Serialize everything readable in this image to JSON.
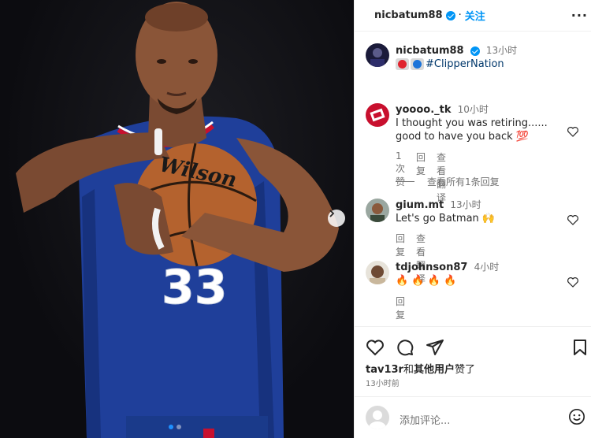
{
  "post": {
    "author": "nicbatum88",
    "follow_label": "关注",
    "separator": "·",
    "more_label": "···",
    "caption_time": "13小时",
    "caption_hashtag": "#ClipperNation",
    "jersey_number": "33",
    "ball_brand": "Wilson"
  },
  "comments": [
    {
      "user": "yoooo._tk",
      "time": "10小时",
      "text": "I thought you was retiring...... good to have you back 💯",
      "likes": "1 次赞",
      "reply": "回复",
      "translate": "查看翻译",
      "view_replies": "查看所有1条回复"
    },
    {
      "user": "gium.mt",
      "time": "13小时",
      "text": "Let's go Batman 🙌",
      "reply": "回复",
      "translate": "查看翻译"
    },
    {
      "user": "tdjohnson87",
      "time": "4小时",
      "text": "🔥 🔥 🔥 🔥",
      "reply": "回复"
    }
  ],
  "likes_line": {
    "user": "tav13r",
    "middle": "和",
    "others": "其他用户",
    "suffix": "赞了"
  },
  "post_time": "13小时前",
  "add_comment": {
    "placeholder": "添加评论..."
  },
  "icons": {
    "heart": "heart-icon",
    "comment": "comment-icon",
    "share": "share-icon",
    "save": "bookmark-icon",
    "emoji": "smile-icon",
    "next": "chevron-right-icon"
  },
  "colors": {
    "accent": "#0095f6",
    "jersey": "#1f3f9a",
    "hashtag": "#00376b"
  }
}
